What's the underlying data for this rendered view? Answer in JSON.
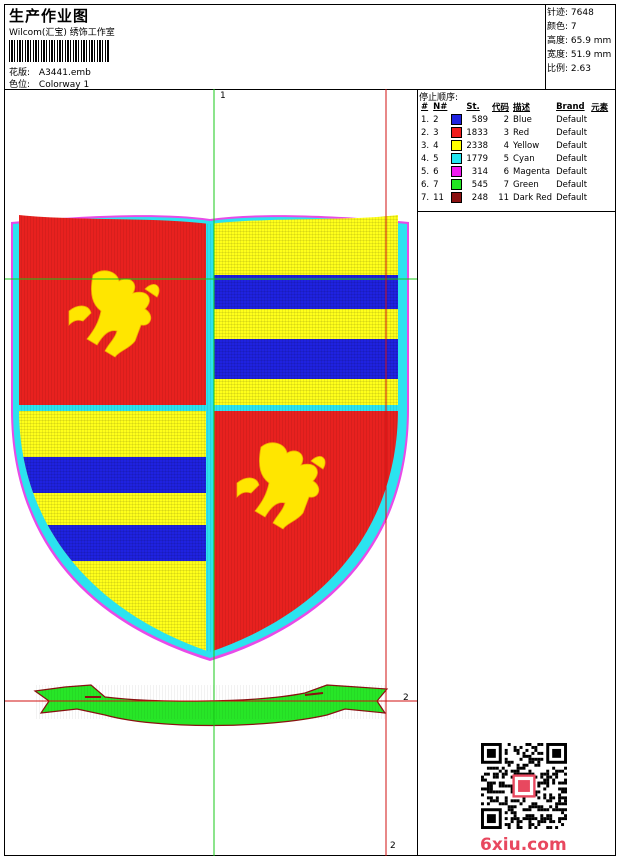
{
  "header": {
    "title": "生产作业图",
    "subtitle": "Wilcom(汇宝) 绣饰工作室",
    "design_label": "花版:",
    "design_value": "A3441.emb",
    "colorway_label": "色位:",
    "colorway_value": "Colorway 1"
  },
  "stats": {
    "stitches": "针迹: 7648",
    "colors": "颜色: 7",
    "height": "高度: 65.9 mm",
    "width": "宽度: 51.9 mm",
    "ratio": "比例: 2.63"
  },
  "stop_sequence": {
    "title": "停止顺序:",
    "headers": [
      "#",
      "N#",
      "St.",
      "代码",
      "描述",
      "Brand",
      "元素"
    ],
    "rows": [
      {
        "idx": "1.",
        "n": "2",
        "swatch": "#1f22e0",
        "st": "589",
        "code": "2",
        "desc": "Blue",
        "brand": "Default"
      },
      {
        "idx": "2.",
        "n": "3",
        "swatch": "#f01d1d",
        "st": "1833",
        "code": "3",
        "desc": "Red",
        "brand": "Default"
      },
      {
        "idx": "3.",
        "n": "4",
        "swatch": "#ffff00",
        "st": "2338",
        "code": "4",
        "desc": "Yellow",
        "brand": "Default"
      },
      {
        "idx": "4.",
        "n": "5",
        "swatch": "#22e6f0",
        "st": "1779",
        "code": "5",
        "desc": "Cyan",
        "brand": "Default"
      },
      {
        "idx": "5.",
        "n": "6",
        "swatch": "#f018f0",
        "st": "314",
        "code": "6",
        "desc": "Magenta",
        "brand": "Default"
      },
      {
        "idx": "6.",
        "n": "7",
        "swatch": "#22e622",
        "st": "545",
        "code": "7",
        "desc": "Green",
        "brand": "Default"
      },
      {
        "idx": "7.",
        "n": "11",
        "swatch": "#8a1111",
        "st": "248",
        "code": "11",
        "desc": "Dark Red",
        "brand": "Default"
      }
    ]
  },
  "axes": {
    "top_label": "1",
    "right_label": "2",
    "bottom_label": "2"
  },
  "watermark": "6xiu.com",
  "colors": {
    "blue": "#1f22e0",
    "red": "#e8211f",
    "yellow": "#ffff1a",
    "cyan": "#2be3ef",
    "magenta": "#e84be8",
    "green": "#27e627",
    "dark_red": "#8a1111",
    "guide_green": "#19c819",
    "guide_red": "#d01010"
  }
}
